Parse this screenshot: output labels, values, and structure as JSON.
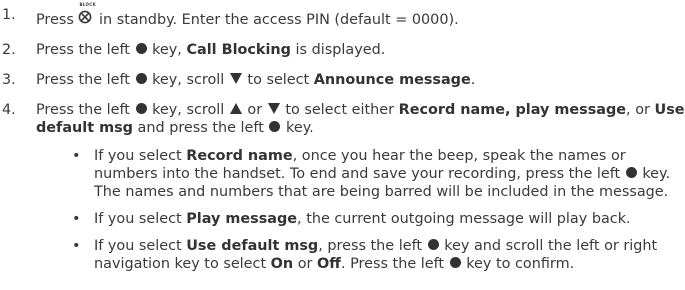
{
  "icons": {
    "block": "block-key-icon",
    "left_key": "black-circle",
    "down": "black-down-triangle",
    "up": "black-up-triangle"
  },
  "colors": {
    "text": "#3a3a3a"
  },
  "block_key_label": "BLOCK",
  "steps": [
    {
      "num": "1.",
      "t1": "Press",
      "t2": "in standby. Enter the access PIN (default = 0000)."
    },
    {
      "num": "2.",
      "t1": "Press the left",
      "t2": "key,",
      "b1": "Call Blocking",
      "t3": "is displayed."
    },
    {
      "num": "3.",
      "t1": "Press the left",
      "t2": "key, scroll",
      "t3": "to select",
      "b1": "Announce message",
      "t4": "."
    },
    {
      "num": "4.",
      "t1": "Press the left",
      "t2": "key, scroll",
      "t3": "or",
      "t4": "to select either",
      "b1": "Record name, play message",
      "t5": ",",
      "t6": "or",
      "b2": "Use default msg",
      "t7": "and press the left",
      "t8": "key."
    }
  ],
  "bullets": [
    {
      "bullet": "•",
      "t1": "If you select",
      "b1": "Record name",
      "t2": ", once you hear the beep, speak the names or numbers into the handset. To end and save your recording, press the left",
      "t3": "key. The names and numbers that are being barred will be included in the message."
    },
    {
      "bullet": "•",
      "t1": "If you select",
      "b1": "Play message",
      "t2": ", the current outgoing message will play back."
    },
    {
      "bullet": "•",
      "t1": "If you select",
      "b1": "Use default msg",
      "t2": ", press the left",
      "t3": "key and scroll the left or right navigation key to select",
      "b2": "On",
      "t4": "or",
      "b3": "Off",
      "t5": ". Press the left",
      "t6": "key to confirm."
    }
  ]
}
